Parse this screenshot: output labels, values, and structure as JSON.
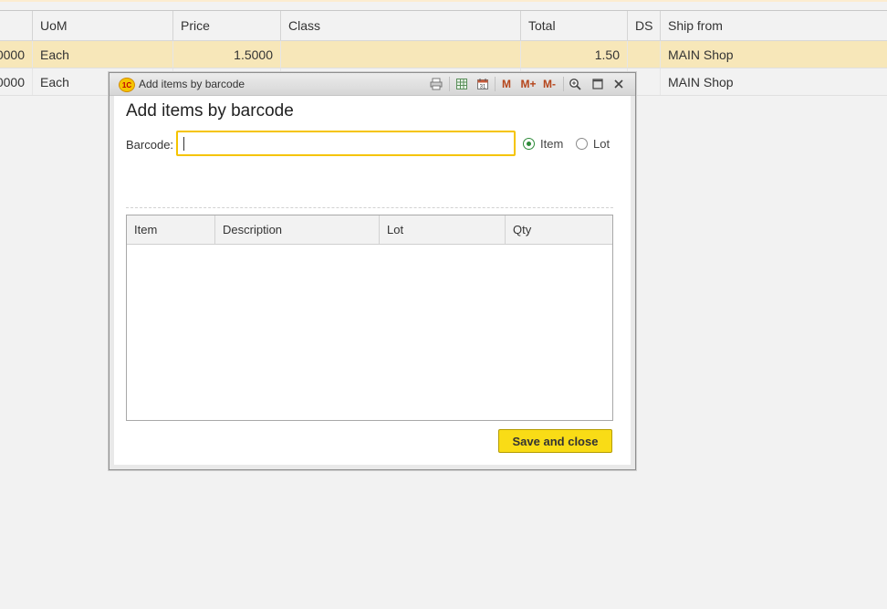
{
  "grid": {
    "columns": [
      "UoM",
      "Price",
      "Class",
      "Total",
      "DS",
      "Ship from"
    ],
    "rows": [
      {
        "qty": "0000",
        "uom": "Each",
        "price": "1.5000",
        "class": "",
        "total": "1.50",
        "ds": "",
        "ship_from": "MAIN Shop"
      },
      {
        "qty": "0000",
        "uom": "Each",
        "price": "",
        "class": "",
        "total": "",
        "ds": "",
        "ship_from": "MAIN Shop"
      }
    ]
  },
  "dialog": {
    "window_title": "Add items by barcode",
    "logo_text": "1C",
    "toolbar_icons": [
      "print-icon",
      "spreadsheet-icon",
      "calendar-icon",
      "memory-m-icon",
      "memory-plus-icon",
      "memory-minus-icon",
      "zoom-icon",
      "maximize-icon",
      "close-icon"
    ],
    "toolbar_text": {
      "m": "M",
      "m_plus": "M+",
      "m_minus": "M-",
      "calendar_day": "31"
    },
    "heading": "Add items by barcode",
    "barcode_label": "Barcode:",
    "barcode_value": "",
    "radio_item": "Item",
    "radio_lot": "Lot",
    "selected_mode": "Item",
    "table_columns": [
      "Item",
      "Description",
      "Lot",
      "Qty"
    ],
    "save_button": "Save and close"
  },
  "colors": {
    "selected_row": "#f7e7b9",
    "accent_yellow": "#f9dc16",
    "input_focus_border": "#f5c400",
    "radio_checked": "#2e8b3a"
  }
}
